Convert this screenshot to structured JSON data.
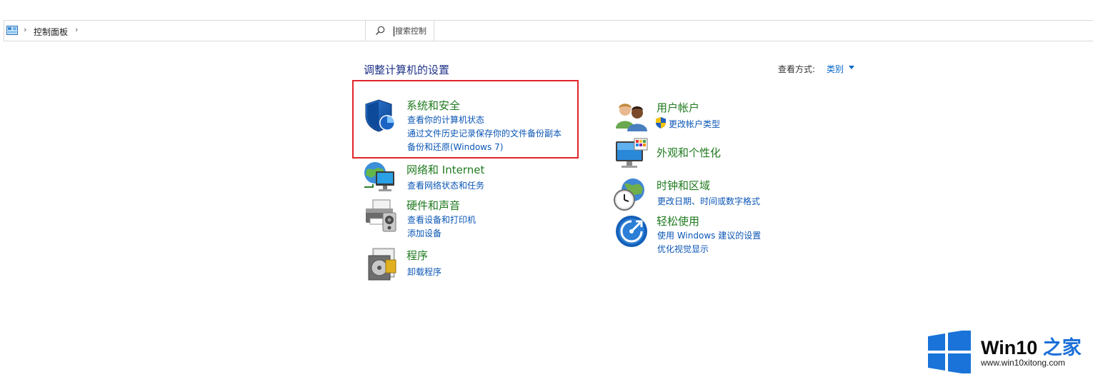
{
  "address_bar": {
    "breadcrumb_label": "控制面板",
    "sep": "›",
    "search_placeholder": "搜索控制"
  },
  "heading": "调整计算机的设置",
  "view_by": {
    "label": "查看方式:",
    "value": "类别"
  },
  "left_categories": [
    {
      "icon": "shield-icon",
      "title": "系统和安全",
      "links": [
        "查看你的计算机状态",
        "通过文件历史记录保存你的文件备份副本",
        "备份和还原(Windows 7)"
      ]
    },
    {
      "icon": "network-globe-icon",
      "title": "网络和 Internet",
      "links": [
        "查看网络状态和任务"
      ]
    },
    {
      "icon": "printer-icon",
      "title": "硬件和声音",
      "links": [
        "查看设备和打印机",
        "添加设备"
      ]
    },
    {
      "icon": "programs-disc-icon",
      "title": "程序",
      "links": [
        "卸载程序"
      ]
    }
  ],
  "right_categories": [
    {
      "icon": "users-icon",
      "title": "用户帐户",
      "links": [
        "更改帐户类型"
      ]
    },
    {
      "icon": "monitor-palette-icon",
      "title": "外观和个性化",
      "links": []
    },
    {
      "icon": "clock-globe-icon",
      "title": "时钟和区域",
      "links": [
        "更改日期、时间或数字格式"
      ]
    },
    {
      "icon": "ease-of-access-icon",
      "title": "轻松使用",
      "links": [
        "使用 Windows 建议的设置",
        "优化视觉显示"
      ]
    }
  ],
  "watermark": {
    "brand": "Win10",
    "brand_suffix": "之家",
    "url": "www.win10xitong.com"
  },
  "colors": {
    "title_green": "#1f7a1f",
    "link_blue": "#0a56b5",
    "heading_navy": "#1e3287",
    "highlight_red": "#e0252b"
  }
}
